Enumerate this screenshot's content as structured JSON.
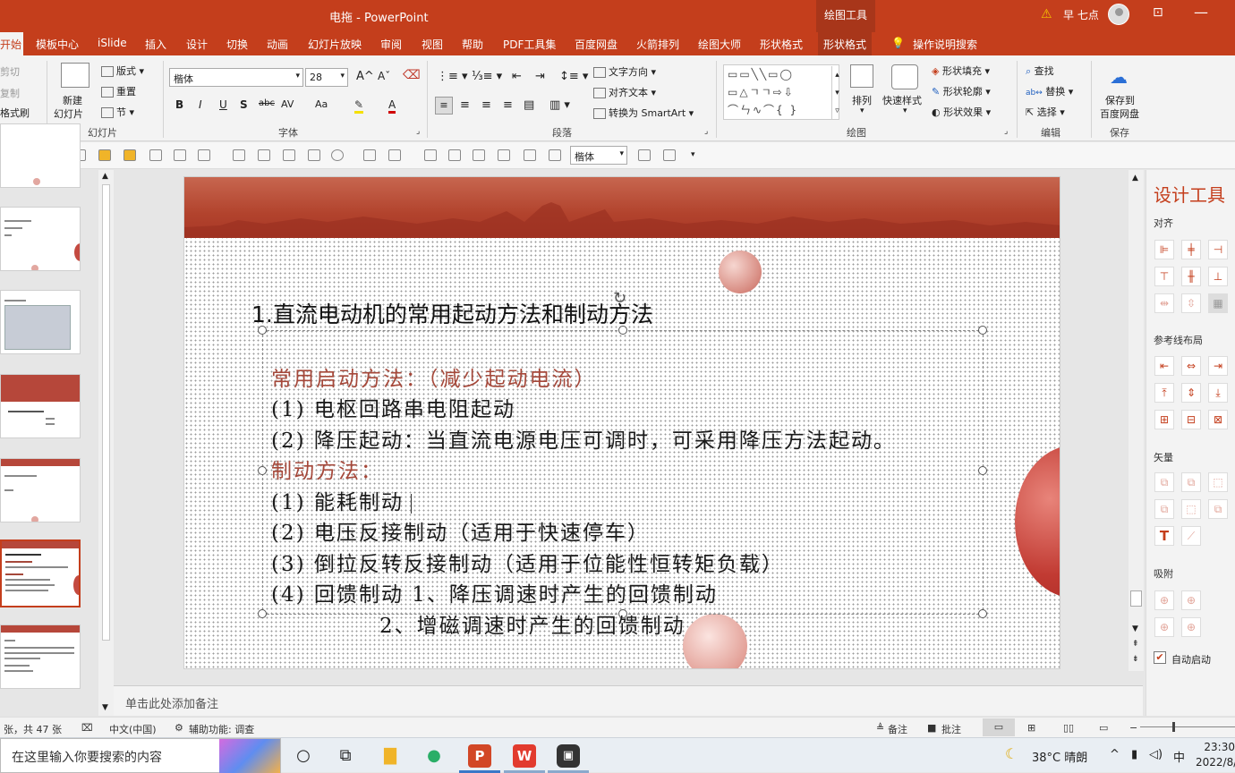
{
  "titlebar": {
    "doc_title": "电拖  -  PowerPoint",
    "context_tab": "绘图工具",
    "user_name": "早 七点",
    "warning_icon": "warning-icon"
  },
  "tabs": [
    "开始",
    "模板中心",
    "iSlide",
    "插入",
    "设计",
    "切换",
    "动画",
    "幻灯片放映",
    "审阅",
    "视图",
    "帮助",
    "PDF工具集",
    "百度网盘",
    "火箭排列",
    "绘图大师",
    "形状格式",
    "形状格式",
    "操作说明搜索"
  ],
  "ribbon": {
    "clipboard": {
      "cut": "剪切",
      "copy": "复制",
      "format_painter": "格式刷"
    },
    "slides": {
      "new_slide": "新建",
      "new_slide_2": "幻灯片",
      "layout": "版式",
      "reset": "重置",
      "section": "节",
      "group": "幻灯片"
    },
    "font": {
      "family": "楷体",
      "size": "28",
      "group": "字体",
      "bold": "B",
      "italic": "I",
      "underline": "U",
      "shadow": "S",
      "strike": "abc",
      "spacing": "AV",
      "case": "Aa",
      "font_color": "A"
    },
    "paragraph": {
      "text_direction": "文字方向",
      "align_text": "对齐文本",
      "smartart": "转换为 SmartArt",
      "group": "段落"
    },
    "drawing": {
      "arrange": "排列",
      "quick_styles": "快速样式",
      "fill": "形状填充",
      "outline": "形状轮廓",
      "effects": "形状效果",
      "group": "绘图"
    },
    "editing": {
      "find": "查找",
      "replace": "替换",
      "select": "选择",
      "group": "编辑"
    },
    "save": {
      "label": "保存到",
      "label2": "百度网盘",
      "group": "保存"
    }
  },
  "qtb": {
    "font": "楷体"
  },
  "slide": {
    "title": "1.直流电动机的常用起动方法和制动方法",
    "lines": [
      {
        "text": "常用启动方法：（减少起动电流）",
        "red": true
      },
      {
        "text": "(1) 电枢回路串电阻起动",
        "red": false
      },
      {
        "text": "(2) 降压起动：当直流电源电压可调时，可采用降压方法起动。",
        "red": false
      },
      {
        "text": "制动方法：",
        "red": true
      },
      {
        "text": "(1) 能耗制动",
        "red": false
      },
      {
        "text": "(2) 电压反接制动（适用于快速停车）",
        "red": false
      },
      {
        "text": "(3) 倒拉反转反接制动（适用于位能性恒转矩负载）",
        "red": false
      },
      {
        "text": "(4) 回馈制动 1、降压调速时产生的回馈制动",
        "red": false
      },
      {
        "text": "             2、增磁调速时产生的回馈制动",
        "red": false
      }
    ]
  },
  "right_pane": {
    "header": "设计工具",
    "align": "对齐",
    "guides": "参考线布局",
    "vector": "矢量",
    "snap": "吸附",
    "auto_start": "自动启动"
  },
  "notes": {
    "placeholder": "单击此处添加备注"
  },
  "statusbar": {
    "slide_count": "张，共 47 张",
    "language": "中文(中国)",
    "accessibility": "辅助功能: 调查",
    "notes": "备注",
    "comments": "批注"
  },
  "taskbar": {
    "search_placeholder": "在这里输入你要搜索的内容",
    "weather": "38°C  晴朗",
    "ime": "中",
    "time": "23:30",
    "date": "2022/8/"
  }
}
